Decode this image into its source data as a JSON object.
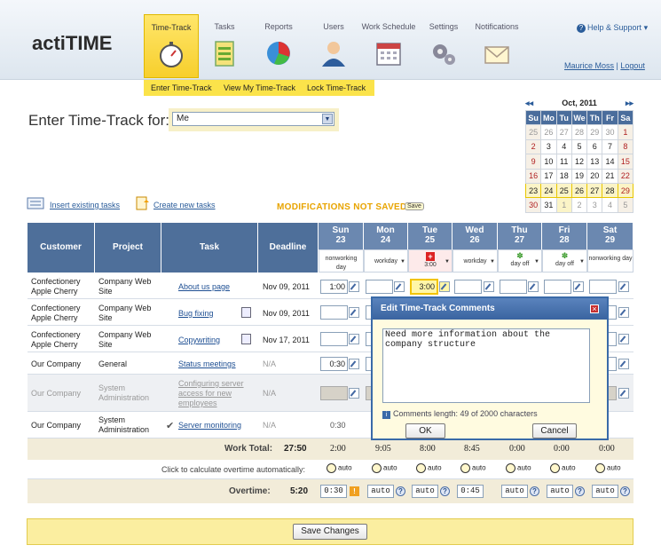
{
  "header": {
    "logo": "actiTIME",
    "tabs": [
      {
        "label": "Time-Track",
        "icon": "stopwatch-icon",
        "active": true
      },
      {
        "label": "Tasks",
        "icon": "clipboard-icon"
      },
      {
        "label": "Reports",
        "icon": "pie-chart-icon"
      },
      {
        "label": "Users",
        "icon": "user-icon"
      },
      {
        "label": "Work Schedule",
        "icon": "calendar-icon"
      },
      {
        "label": "Settings",
        "icon": "gears-icon"
      },
      {
        "label": "Notifications",
        "icon": "envelope-icon"
      }
    ],
    "help": "Help & Support",
    "user_name": "Maurice Moss",
    "logout": "Logout"
  },
  "subnav": [
    "Enter Time-Track",
    "View My Time-Track",
    "Lock Time-Track"
  ],
  "page_title": "Enter Time-Track for:",
  "user_select": "Me",
  "calendar": {
    "month": "Oct, 2011",
    "prev": "◂◂",
    "next": "▸▸",
    "day_names": [
      "Su",
      "Mo",
      "Tu",
      "We",
      "Th",
      "Fr",
      "Sa"
    ],
    "weeks": [
      [
        "25",
        "26",
        "27",
        "28",
        "29",
        "30",
        "1"
      ],
      [
        "2",
        "3",
        "4",
        "5",
        "6",
        "7",
        "8"
      ],
      [
        "9",
        "10",
        "11",
        "12",
        "13",
        "14",
        "15"
      ],
      [
        "16",
        "17",
        "18",
        "19",
        "20",
        "21",
        "22"
      ],
      [
        "23",
        "24",
        "25",
        "26",
        "27",
        "28",
        "29"
      ],
      [
        "30",
        "31",
        "1",
        "2",
        "3",
        "4",
        "5"
      ]
    ]
  },
  "actions": {
    "insert_existing": "Insert existing tasks",
    "create_new": "Create new tasks",
    "modifications": "MODIFICATIONS NOT SAVED",
    "save_small": "Save"
  },
  "grid": {
    "col_headers": {
      "customer": "Customer",
      "project": "Project",
      "task": "Task",
      "deadline": "Deadline"
    },
    "days": [
      {
        "name": "Sun",
        "num": "23",
        "sub": "nonworking day"
      },
      {
        "name": "Mon",
        "num": "24",
        "sub": "workday"
      },
      {
        "name": "Tue",
        "num": "25",
        "sub": "3:00"
      },
      {
        "name": "Wed",
        "num": "26",
        "sub": "workday"
      },
      {
        "name": "Thu",
        "num": "27",
        "sub": "day off"
      },
      {
        "name": "Fri",
        "num": "28",
        "sub": "day off"
      },
      {
        "name": "Sat",
        "num": "29",
        "sub": "nonworking day"
      }
    ],
    "rows": [
      {
        "customer": "Confectionery Apple Cherry",
        "project": "Company Web Site",
        "task": "About us page",
        "deadline": "Nov 09, 2011",
        "sun": "1:00",
        "tue": "3:00"
      },
      {
        "customer": "Confectionery Apple Cherry",
        "project": "Company Web Site",
        "task": "Bug fixing",
        "deadline": "Nov 09, 2011"
      },
      {
        "customer": "Confectionery Apple Cherry",
        "project": "Company Web Site",
        "task": "Copywriting",
        "deadline": "Nov 17, 2011"
      },
      {
        "customer": "Our Company",
        "project": "General",
        "task": "Status meetings",
        "deadline": "N/A",
        "sun": "0:30"
      },
      {
        "customer": "Our Company",
        "project": "System Administration",
        "task": "Configuring server access for new employees",
        "deadline": "N/A"
      },
      {
        "customer": "Our Company",
        "project": "System Administration",
        "task": "Server monitoring",
        "deadline": "N/A",
        "sun": "0:30"
      }
    ],
    "work_total_label": "Work Total:",
    "work_total": "27:50",
    "day_totals": [
      "2:00",
      "9:05",
      "8:00",
      "8:45",
      "0:00",
      "0:00",
      "0:00"
    ],
    "overtime_hint": "Click to calculate overtime automatically:",
    "auto_label": "auto",
    "overtime_label": "Overtime:",
    "overtime_total": "5:20",
    "overtime_values": [
      "0:30",
      "auto",
      "auto",
      "0:45",
      "auto",
      "auto",
      "auto"
    ]
  },
  "dialog": {
    "title": "Edit Time-Track Comments",
    "comment": "Need more information about the company structure",
    "info": "Comments length: 49 of 2000 characters",
    "ok": "OK",
    "cancel": "Cancel"
  },
  "footer": {
    "save_button": "Save Changes"
  },
  "colors": {
    "header_blue": "#4e6f9a",
    "accent_yellow": "#fbe34a",
    "link": "#1e4f93"
  }
}
